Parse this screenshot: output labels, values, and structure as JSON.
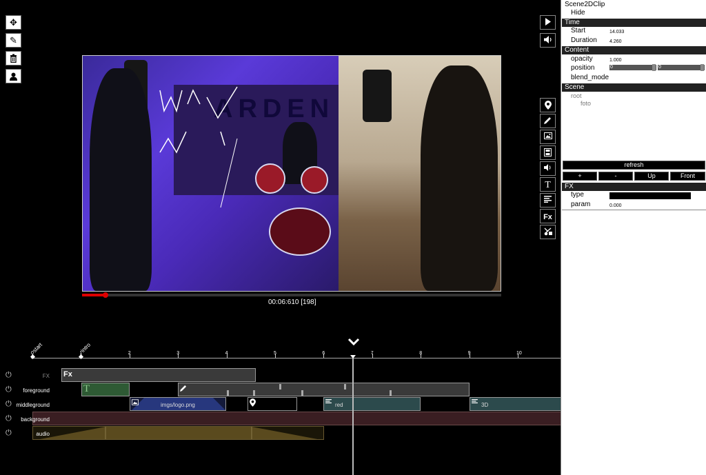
{
  "viewer": {
    "timecode": "00:06:610  [198]",
    "progress_fraction": 0.056,
    "poster_text": "ARDEN"
  },
  "left_toolbar": [
    "move-icon",
    "edit-icon",
    "trash-icon",
    "user-icon"
  ],
  "right_toolbar_top": [
    "play-icon",
    "volume-icon"
  ],
  "right_toolbar": [
    "location-icon",
    "pencil-icon",
    "image-icon",
    "film-icon",
    "audio-icon",
    "text-icon",
    "align-icon",
    "fx-icon",
    "scissors-icon"
  ],
  "right_toolbar_labels": {
    "text": "T",
    "fx": "Fx"
  },
  "timeline": {
    "ticks": [
      "0",
      "1",
      "2",
      "3",
      "4",
      "5",
      "6",
      "7",
      "8",
      "9",
      "10"
    ],
    "markers": [
      {
        "label": "start",
        "time": 0
      },
      {
        "label": "intro",
        "time": 1
      }
    ],
    "playhead_time": 6.6,
    "tracks": [
      {
        "name": "FX",
        "enabled": true
      },
      {
        "name": "foreground",
        "enabled": true
      },
      {
        "name": "middleground",
        "enabled": true
      },
      {
        "name": "background",
        "enabled": true
      },
      {
        "name": "audio",
        "enabled": true
      }
    ],
    "clips": {
      "fx": {
        "label": "Fx"
      },
      "fg_text": {
        "label": "T"
      },
      "mid_image": {
        "label": "imgs/logo.png"
      },
      "mid_red": {
        "label": "red"
      },
      "mid_3d": {
        "label": "3D"
      }
    }
  },
  "inspector": {
    "title": "Scene2DClip",
    "hide_label": "Hide",
    "time": {
      "header": "Time",
      "start_label": "Start",
      "start_value": "14.033",
      "duration_label": "Duration",
      "duration_value": "4.260"
    },
    "content": {
      "header": "Content",
      "opacity_label": "opacity",
      "opacity_value": "1.000",
      "position_label": "position",
      "position_x": "0",
      "position_y": "0",
      "blend_label": "blend_mode"
    },
    "scene": {
      "header": "Scene",
      "root": "root",
      "child": "foto"
    },
    "buttons": {
      "refresh": "refresh",
      "plus": "+",
      "minus": "-",
      "up": "Up",
      "front": "Front"
    },
    "fx": {
      "header": "FX",
      "type_label": "type",
      "param_label": "param",
      "param_value": "0.000"
    }
  },
  "colors": {
    "accent_red": "#dd0000",
    "text_clip": "#2e5a34",
    "image_clip": "#2a3d8a",
    "teal_clip": "#2c4a4c",
    "background_track": "#3a1e22",
    "audio_clip": "#5a4a1e"
  }
}
